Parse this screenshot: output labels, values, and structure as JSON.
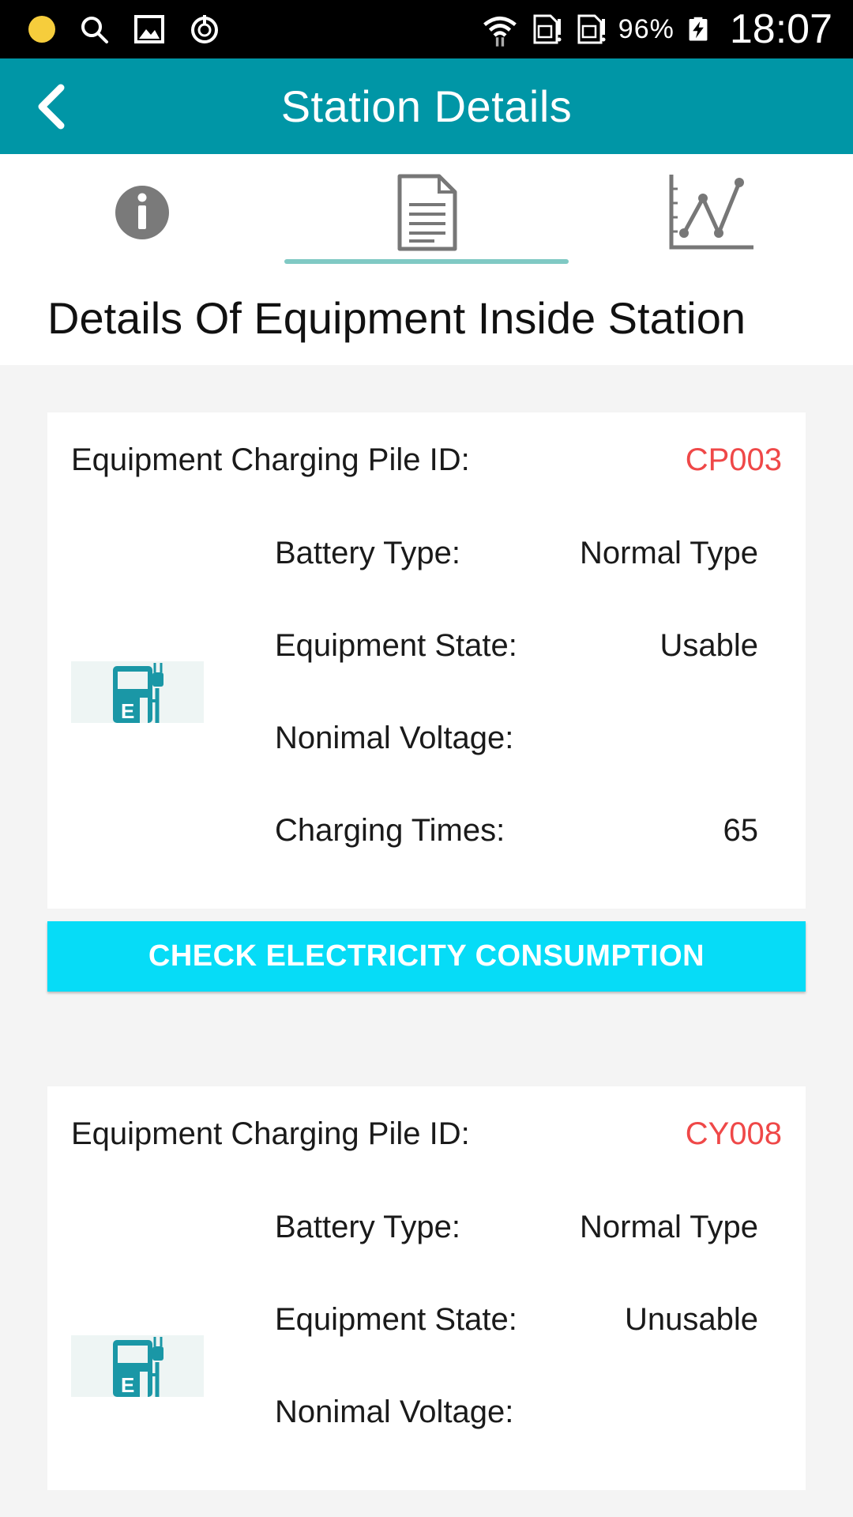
{
  "status_bar": {
    "battery_percent": "96%",
    "time": "18:07",
    "icons": [
      "notification-dot",
      "search-icon",
      "image-icon",
      "sync-icon",
      "wifi-icon",
      "sim-icon",
      "sim-icon",
      "battery-charging-icon"
    ]
  },
  "app_bar": {
    "title": "Station Details",
    "back_icon": "chevron-left-icon"
  },
  "tabs": [
    {
      "icon": "info-icon",
      "active": false
    },
    {
      "icon": "document-icon",
      "active": true
    },
    {
      "icon": "line-chart-icon",
      "active": false
    }
  ],
  "section": {
    "title": "Details Of Equipment Inside Station"
  },
  "equipment": [
    {
      "id_label": "Equipment Charging Pile ID:",
      "id_value": "CP003",
      "icon": "charging-station-icon",
      "fields": [
        {
          "label": "Battery Type:",
          "value": "Normal Type"
        },
        {
          "label": "Equipment State:",
          "value": "Usable"
        },
        {
          "label": "Nonimal Voltage:",
          "value": ""
        },
        {
          "label": "Charging Times:",
          "value": "65"
        }
      ],
      "button_label": "CHECK ELECTRICITY CONSUMPTION"
    },
    {
      "id_label": "Equipment Charging Pile ID:",
      "id_value": "CY008",
      "icon": "charging-station-icon",
      "fields": [
        {
          "label": "Battery Type:",
          "value": "Normal Type"
        },
        {
          "label": "Equipment State:",
          "value": "Unusable"
        },
        {
          "label": "Nonimal Voltage:",
          "value": ""
        }
      ]
    }
  ],
  "colors": {
    "app_bar": "#0096a6",
    "tab_indicator": "#80c9c4",
    "id_value": "#ef4848",
    "action_button": "#06dcf7",
    "icon_teal": "#1a97a6"
  }
}
